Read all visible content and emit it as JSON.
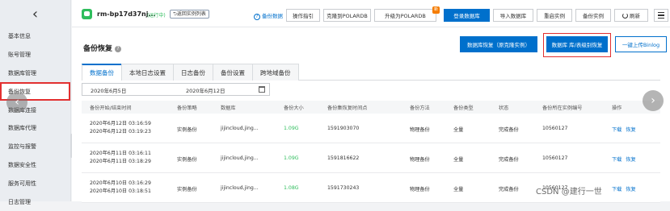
{
  "sidebar": {
    "back_glyph": "‹",
    "items": [
      {
        "label": "基本信息"
      },
      {
        "label": "账号管理"
      },
      {
        "label": "数据库管理"
      },
      {
        "label": "备份恢复"
      },
      {
        "label": "数据库连接"
      },
      {
        "label": "数据库代理"
      },
      {
        "label": "监控与报警"
      },
      {
        "label": "数据安全性"
      },
      {
        "label": "服务可用性"
      },
      {
        "label": "日志管理"
      }
    ]
  },
  "header": {
    "instance_name": "rm-bp17d37nj...",
    "status": "(运行中)",
    "back_to_list": "返回实例列表",
    "backup_data_link": "备份数据",
    "buttons": {
      "guide": "操作指引",
      "clone_polardb": "克隆到POLARDB",
      "upgrade_polardb": "升级为POLARDB",
      "login_db": "登录数据库",
      "import_db": "导入数据库",
      "restart": "重启实例",
      "backup_instance": "备份实例",
      "refresh": "刷新"
    },
    "new_badge": "新"
  },
  "page": {
    "title": "备份恢复",
    "help": "?",
    "actions": {
      "restore_clone": "数据库恢复（原克隆实例）",
      "restore_db_table": "数据库 库/表级别恢复",
      "upload_binlog": "一键上传Binlog"
    },
    "tabs": [
      "数据备份",
      "本地日志设置",
      "日志备份",
      "备份设置",
      "跨地域备份"
    ],
    "date_from": "2020年6月5日",
    "date_to": "2020年6月12日"
  },
  "table": {
    "columns": [
      "备份开始/结束时间",
      "备份策略",
      "数据库",
      "备份大小",
      "备份集恢复时间点",
      "备份方法",
      "备份类型",
      "状态",
      "备份所在实例编号",
      "操作"
    ],
    "rows": [
      {
        "start": "2020年6月12日 03:16:59",
        "end": "2020年6月12日 03:19:23",
        "policy": "实例备份",
        "database": "jijincloud,jing...",
        "size": "1.09G",
        "restore_point": "1591903070",
        "method": "物理备份",
        "type": "全量",
        "status": "完成备份",
        "instance_no": "10560127",
        "ops": [
          "下载",
          "恢复"
        ]
      },
      {
        "start": "2020年6月11日 03:16:11",
        "end": "2020年6月11日 03:18:29",
        "policy": "实例备份",
        "database": "jijincloud,jing...",
        "size": "1.09G",
        "restore_point": "1591816622",
        "method": "物理备份",
        "type": "全量",
        "status": "完成备份",
        "instance_no": "10560127",
        "ops": [
          "下载",
          "恢复"
        ]
      },
      {
        "start": "2020年6月10日 03:16:29",
        "end": "2020年6月10日 03:18:51",
        "policy": "实例备份",
        "database": "jijincloud,jing...",
        "size": "1.08G",
        "restore_point": "1591730243",
        "method": "物理备份",
        "type": "全量",
        "status": "完成备份",
        "instance_no": "10560127",
        "ops": [
          "下载",
          "恢复"
        ]
      }
    ]
  },
  "watermark": "CSDN @建行一世",
  "colors": {
    "primary": "#0070cc",
    "success": "#2ebd5c",
    "highlight": "#e23030"
  }
}
